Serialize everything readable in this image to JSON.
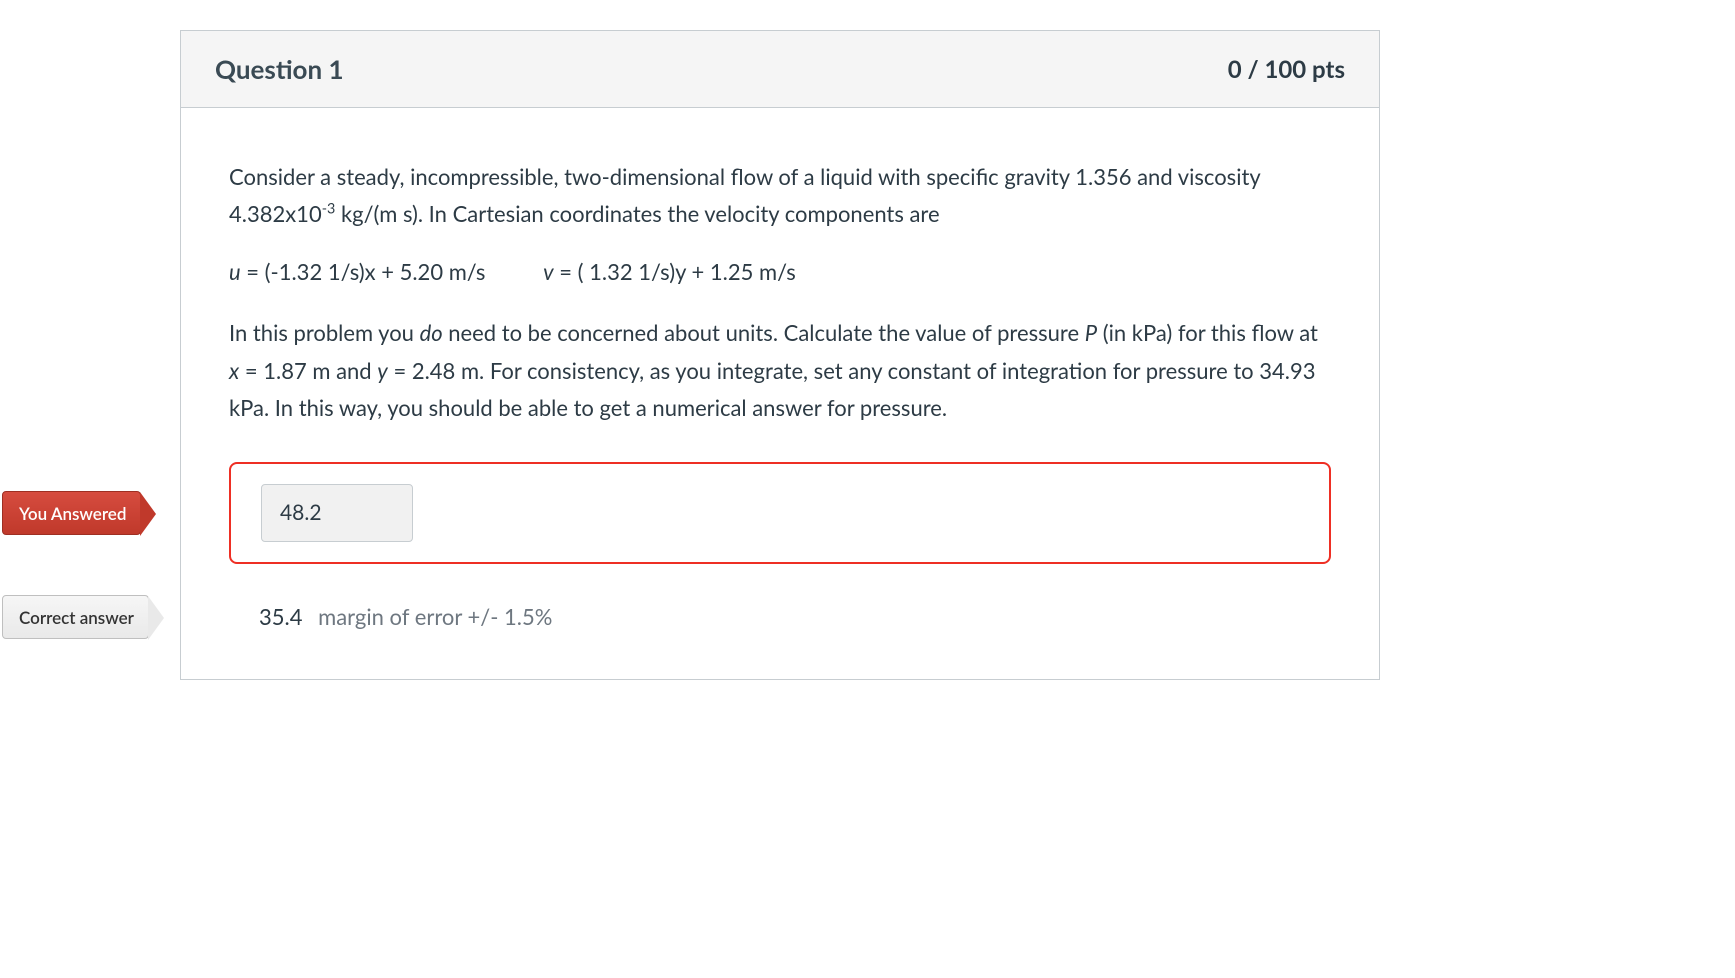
{
  "header": {
    "title": "Question 1",
    "points": "0 / 100 pts"
  },
  "body": {
    "p1_a": "Consider a steady, incompressible, two-dimensional flow of a liquid with specific gravity 1.356 and viscosity 4.382x10",
    "p1_sup": "-3",
    "p1_b": " kg/(m s). In Cartesian coordinates the velocity components are",
    "eq_u_var": "u",
    "eq_u_rest": " = (-1.32 1/s)x + 5.20 m/s",
    "eq_v_var": "v",
    "eq_v_rest": " = ( 1.32 1/s)y + 1.25 m/s",
    "p2_a": "In this problem you ",
    "p2_do": "do",
    "p2_b": " need to be concerned about units. Calculate the value of pressure ",
    "p2_P": "P",
    "p2_c": " (in kPa) for this flow at ",
    "p2_x": "x",
    "p2_d": " = 1.87 m and ",
    "p2_y": "y",
    "p2_e": " = 2.48 m. For consistency, as you integrate, set any constant of integration for pressure to 34.93 kPa. In this way, you should be able to get a numerical answer for pressure."
  },
  "flags": {
    "you_answered": "You Answered",
    "correct_answer": "Correct answer"
  },
  "answers": {
    "user_value": "48.2",
    "correct_value": "35.4",
    "margin": "margin of error +/- 1.5%"
  }
}
